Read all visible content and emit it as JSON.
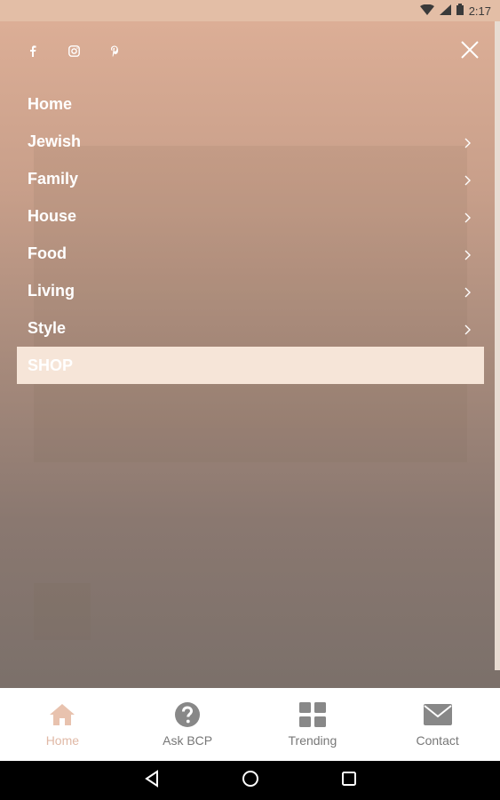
{
  "status_bar": {
    "time": "2:17"
  },
  "social": {
    "icons": [
      "facebook-icon",
      "instagram-icon",
      "pinterest-icon"
    ]
  },
  "menu": {
    "items": [
      {
        "label": "Home",
        "has_submenu": false
      },
      {
        "label": "Jewish",
        "has_submenu": true
      },
      {
        "label": "Family",
        "has_submenu": true
      },
      {
        "label": "House",
        "has_submenu": true
      },
      {
        "label": "Food",
        "has_submenu": true
      },
      {
        "label": "Living",
        "has_submenu": true
      },
      {
        "label": "Style",
        "has_submenu": true
      },
      {
        "label": "SHOP",
        "has_submenu": false,
        "highlighted": true
      }
    ]
  },
  "tabs": [
    {
      "label": "Home",
      "icon": "home-icon",
      "active": true
    },
    {
      "label": "Ask BCP",
      "icon": "question-icon",
      "active": false
    },
    {
      "label": "Trending",
      "icon": "grid-icon",
      "active": false
    },
    {
      "label": "Contact",
      "icon": "envelope-icon",
      "active": false
    }
  ],
  "colors": {
    "accent": "#e0b9a6",
    "shop_highlight": "#f6e5d8"
  }
}
